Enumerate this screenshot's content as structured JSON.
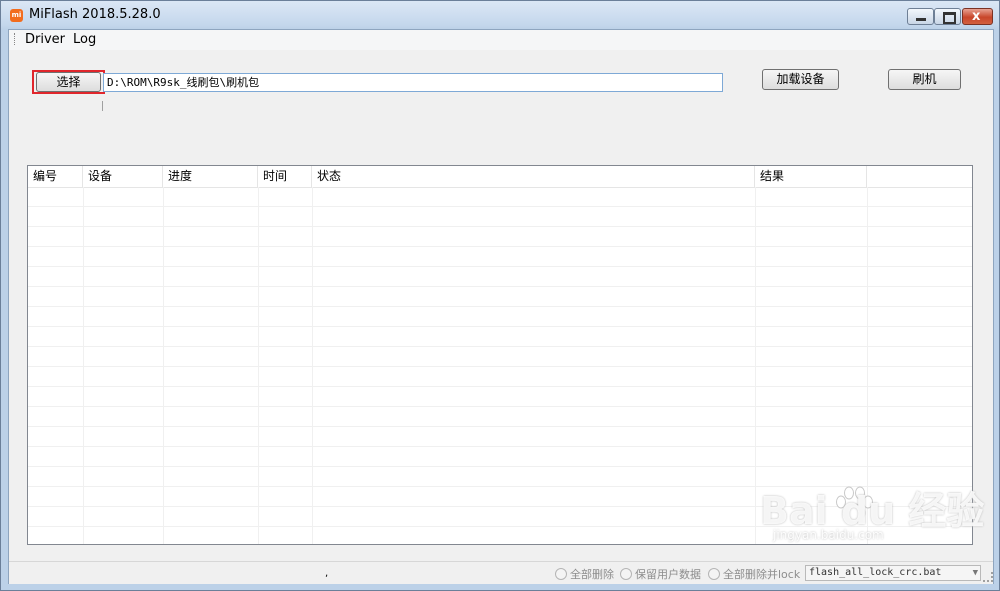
{
  "window": {
    "title": "MiFlash 2018.5.28.0",
    "app_icon": "mi-logo-icon",
    "close_symbol": "x"
  },
  "menu": {
    "items": [
      "Driver",
      "Log"
    ]
  },
  "toolbar": {
    "select_label": "选择",
    "path_value": "D:\\ROM\\R9sk_线刷包\\刷机包",
    "load_devices_label": "加载设备",
    "flash_label": "刷机"
  },
  "table": {
    "columns": [
      "编号",
      "设备",
      "进度",
      "时间",
      "状态",
      "结果",
      ""
    ],
    "rows": []
  },
  "statusbar": {
    "dot": ",",
    "options": [
      "全部删除",
      "保留用户数据",
      "全部删除并lock"
    ],
    "script_value": "flash_all_lock_crc.bat",
    "script_arrow": "▼"
  },
  "watermark": {
    "brand": "Bai du 经验",
    "url": "jingyan.baidu.com"
  },
  "colors": {
    "highlight_border": "#e0262c",
    "title_gradient": "#c4d7ec"
  }
}
